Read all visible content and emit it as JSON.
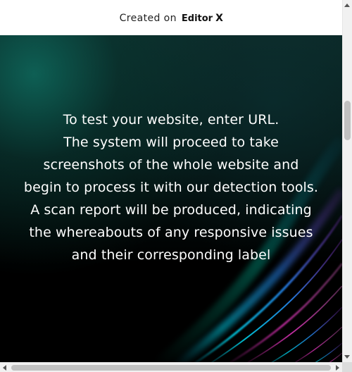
{
  "top_banner": {
    "created_label": "Created on",
    "brand_name": "Editor",
    "brand_mark": "X"
  },
  "hero": {
    "lines": [
      "To test your website, enter URL.",
      "The system will proceed to take",
      "screenshots of the whole website and",
      "begin to process it with our detection tools.",
      "A scan report will be produced, indicating",
      "the whereabouts of any responsive issues",
      "and their corresponding label"
    ],
    "background_colors": {
      "dark": "#000000",
      "teal": "#0b2725",
      "accent_cyan": "#27d8ff",
      "accent_blue": "#2a63ff",
      "accent_magenta": "#ff3bd4"
    }
  },
  "icons": {
    "scroll_up": "scroll-up-arrow-icon",
    "scroll_down": "scroll-down-arrow-icon",
    "scroll_left": "scroll-left-arrow-icon",
    "scroll_right": "scroll-right-arrow-icon"
  }
}
